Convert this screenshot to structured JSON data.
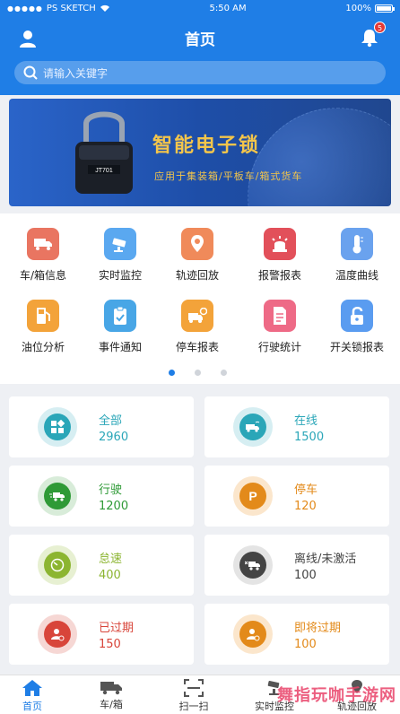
{
  "status_bar": {
    "carrier": "PS SKETCH",
    "time": "5:50 AM",
    "battery": "100%"
  },
  "header": {
    "title": "首页",
    "notification_count": "5"
  },
  "search": {
    "placeholder": "请输入关键字"
  },
  "banner": {
    "title": "智能电子锁",
    "subtitle": "应用于集装箱/平板车/箱式货车",
    "device_label": "JT701"
  },
  "menu": {
    "items": [
      {
        "label": "车/箱信息",
        "icon": "truck-icon",
        "color": "#e97561"
      },
      {
        "label": "实时监控",
        "icon": "camera-icon",
        "color": "#5aa8f0"
      },
      {
        "label": "轨迹回放",
        "icon": "map-pin-icon",
        "color": "#f08a5a"
      },
      {
        "label": "报警报表",
        "icon": "alarm-icon",
        "color": "#e2505a"
      },
      {
        "label": "温度曲线",
        "icon": "thermometer-icon",
        "color": "#6aa2ee"
      },
      {
        "label": "油位分析",
        "icon": "fuel-icon",
        "color": "#f3a33a"
      },
      {
        "label": "事件通知",
        "icon": "clipboard-check-icon",
        "color": "#48a6e6"
      },
      {
        "label": "停车报表",
        "icon": "parking-truck-icon",
        "color": "#f3a33a"
      },
      {
        "label": "行驶统计",
        "icon": "document-icon",
        "color": "#ee6a86"
      },
      {
        "label": "开关锁报表",
        "icon": "unlock-icon",
        "color": "#5a9cf0"
      }
    ],
    "page_count": 3,
    "active_page": 0
  },
  "stats": [
    {
      "label": "全部",
      "value": "2960",
      "color": "#2aa6b8",
      "icon": "grid-icon"
    },
    {
      "label": "在线",
      "value": "1500",
      "color": "#2aa6b8",
      "icon": "online-truck-icon"
    },
    {
      "label": "行驶",
      "value": "1200",
      "color": "#2e9a36",
      "icon": "moving-truck-icon"
    },
    {
      "label": "停车",
      "value": "120",
      "color": "#e38a1a",
      "icon": "parking-icon"
    },
    {
      "label": "怠速",
      "value": "400",
      "color": "#8cb531",
      "icon": "gauge-icon"
    },
    {
      "label": "离线/未激活",
      "value": "100",
      "color": "#444444",
      "icon": "offline-truck-icon"
    },
    {
      "label": "已过期",
      "value": "150",
      "color": "#d8453a",
      "icon": "expired-user-icon"
    },
    {
      "label": "即将过期",
      "value": "100",
      "color": "#e38a1a",
      "icon": "expiring-user-icon"
    }
  ],
  "tabbar": {
    "tabs": [
      {
        "label": "首页",
        "icon": "home-icon",
        "active": true
      },
      {
        "label": "车/箱",
        "icon": "truck-icon",
        "active": false
      },
      {
        "label": "扫一扫",
        "icon": "scan-icon",
        "active": false
      },
      {
        "label": "实时监控",
        "icon": "monitor-icon",
        "active": false
      },
      {
        "label": "轨迹回放",
        "icon": "route-icon",
        "active": false
      }
    ]
  },
  "watermark": "舞指玩咖手游网",
  "colors": {
    "primary": "#1f7ee6",
    "banner_text": "#f3c54b"
  }
}
